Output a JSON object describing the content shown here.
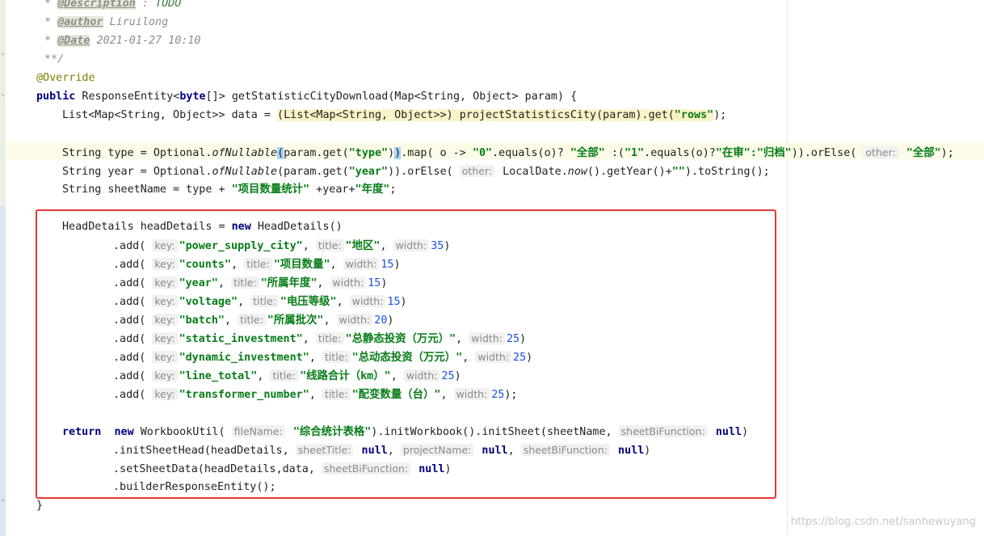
{
  "comment": {
    "description_tag": "@Description",
    "description_sep": " : ",
    "description_value": "TODO",
    "author_tag": "@author",
    "author_value": " Liruilong",
    "date_tag": "@Date",
    "date_value": " 2021-01-27 10:10",
    "end": "**/"
  },
  "code": {
    "override": "@Override",
    "public": "public",
    "response_entity": " ResponseEntity<",
    "byte_kw": "byte",
    "method_sig": "[]> getStatisticCityDownload(Map<String, Object> param) {",
    "list_decl": "List<Map<String, Object>> data = ",
    "list_cast": "(List<Map<String, Object>>) projectStatisticsCity(param).get(",
    "rows_str": "\"rows\"",
    "list_end": ");",
    "type_a": "String type = Optional.",
    "ofnullable": "ofNullable",
    "type_paren": "(",
    "type_b": "param.get(",
    "type_str": "\"type\"",
    "type_c": ")",
    "type_paren_close": ")",
    "type_d": ".map( o -> ",
    "zero_str": "\"0\"",
    "type_e": ".equals(o)? ",
    "all_str": "\"全部\"",
    "type_f": " :(",
    "one_str": "\"1\"",
    "type_g": ".equals(o)?",
    "review_str": "\"在审\"",
    "type_h": ":",
    "archive_str": "\"归档\"",
    "type_i": ")).orElse( ",
    "other_hint": "other:",
    "all_str2": " \"全部\"",
    "type_j": ");",
    "year_a": "String year = Optional.",
    "year_b": "(param.get(",
    "year_str": "\"year\"",
    "year_c": ")).orElse( ",
    "year_d": " LocalDate.",
    "now": "now",
    "year_e": "().getYear()+",
    "empty_str": "\"\"",
    "year_f": ").toString();",
    "sheet_a": "String sheetName = type + ",
    "sheet_str": "\"项目数量统计\"",
    "sheet_b": " +year+",
    "sheet_str2": "\"年度\"",
    "sheet_c": ";",
    "hd_a": "HeadDetails headDetails = ",
    "new": "new",
    "hd_b": " HeadDetails()",
    "return": "return",
    "wb_a": " WorkbookUtil( ",
    "filename_hint": "fileName:",
    "filename_str": " \"综合统计表格\"",
    "wb_b": ").initWorkbook().initSheet(sheetName, ",
    "sheetbi_hint": "sheetBiFunction:",
    "null": " null",
    "wb_c": ")",
    "head_a": ".initSheetHead(headDetails, ",
    "sheettitle_hint": "sheetTitle:",
    "comma": ", ",
    "projectname_hint": "projectName:",
    "data_a": ".setSheetData(headDetails,data, ",
    "builder": ".builderResponseEntity();",
    "close_brace": "}"
  },
  "adds": [
    {
      "key": "\"power_supply_city\"",
      "title": "\"地区\"",
      "width": "35",
      "end": ")"
    },
    {
      "key": "\"counts\"",
      "title": "\"项目数量\"",
      "width": "15",
      "end": ")"
    },
    {
      "key": "\"year\"",
      "title": "\"所属年度\"",
      "width": "15",
      "end": ")"
    },
    {
      "key": "\"voltage\"",
      "title": "\"电压等级\"",
      "width": "15",
      "end": ")"
    },
    {
      "key": "\"batch\"",
      "title": "\"所属批次\"",
      "width": "20",
      "end": ")"
    },
    {
      "key": "\"static_investment\"",
      "title": "\"总静态投资（万元）\"",
      "width": "25",
      "end": ")"
    },
    {
      "key": "\"dynamic_investment\"",
      "title": "\"总动态投资（万元）\"",
      "width": "25",
      "end": ")"
    },
    {
      "key": "\"line_total\"",
      "title": "\"线路合计（km）\"",
      "width": "25",
      "end": ")"
    },
    {
      "key": "\"transformer_number\"",
      "title": "\"配变数量（台）\"",
      "width": "25",
      "end": ");"
    }
  ],
  "hints": {
    "add_prefix": ".add( ",
    "key": "key:",
    "title": "title:",
    "width": "width:",
    "sep": ", "
  },
  "watermark": "https://blog.csdn.net/sanhewuyang",
  "colors": {
    "keyword": "#000080",
    "string": "#067d17",
    "number": "#1750eb",
    "highlight_box": "#e53935"
  }
}
